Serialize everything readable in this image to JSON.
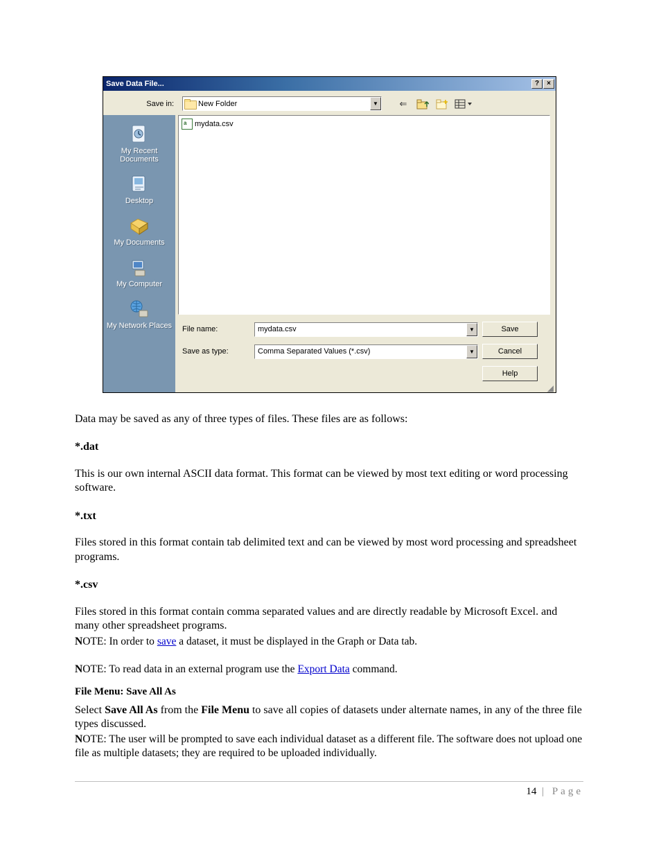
{
  "dialog": {
    "title": "Save Data File...",
    "save_in_label": "Save in:",
    "save_in_value": "New Folder",
    "files": [
      {
        "name": "mydata.csv"
      }
    ],
    "places": [
      {
        "label": "My Recent Documents"
      },
      {
        "label": "Desktop"
      },
      {
        "label": "My Documents"
      },
      {
        "label": "My Computer"
      },
      {
        "label": "My Network Places"
      }
    ],
    "filename_label": "File name:",
    "filename_value": "mydata.csv",
    "savetype_label": "Save as type:",
    "savetype_value": "Comma Separated Values (*.csv)",
    "buttons": {
      "save": "Save",
      "cancel": "Cancel",
      "help": "Help"
    }
  },
  "doc": {
    "p_intro": "Data may be saved as any of three types of files. These files are as follows:",
    "h_dat": "*.dat",
    "p_dat": "This is our own internal ASCII data format. This format can be viewed by most text editing or word processing software.",
    "h_txt": "*.txt",
    "p_txt": "Files stored in this format contain tab delimited text and can be viewed by most word processing and spreadsheet programs.",
    "h_csv": "*.csv",
    "p_csv": "Files stored in this format contain comma separated values and are directly readable by Microsoft Excel. and many other spreadsheet programs.",
    "note1_pre": "OTE: In order to ",
    "note1_link": "save",
    "note1_post": " a dataset, it must be displayed in the Graph or Data tab.",
    "note2_pre": "OTE: To read data in an external program use the ",
    "note2_link": "Export Data",
    "note2_post": " command.",
    "h_saveall": "File Menu: Save All As",
    "saveall_1a": "Select ",
    "saveall_1b": "Save All As",
    "saveall_1c": " from the ",
    "saveall_1d": "File Menu",
    "saveall_1e": " to save all copies of datasets under alternate names, in any of the three file types discussed.",
    "note3": "OTE: The user will be prompted to save each individual dataset as a different file. The software does not upload one file as multiple datasets; they are required to be uploaded individually.",
    "N": "N"
  },
  "footer": {
    "page_num": "14",
    "sep": " | ",
    "label": "Page"
  }
}
